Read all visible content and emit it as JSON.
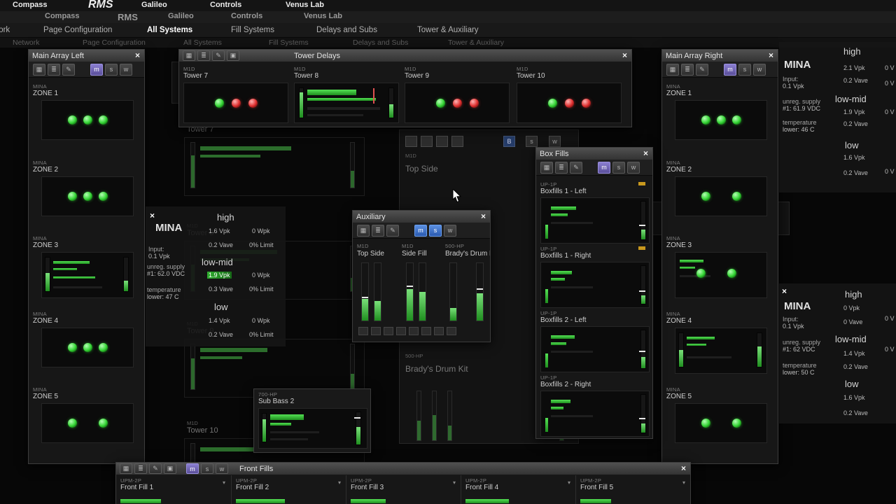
{
  "glyphs": {
    "grid": "▦",
    "list": "≣",
    "edit": "✎",
    "link": "▣",
    "close": "×",
    "m": "m",
    "s": "s",
    "w": "w",
    "b": "B",
    "arrow": "▾"
  },
  "menubar": {
    "items": [
      "Compass",
      "RMS",
      "Galileo",
      "Controls",
      "Venus Lab"
    ]
  },
  "tabs": {
    "network": "Network",
    "items": [
      "Page Configuration",
      "All Systems",
      "Fill Systems",
      "Delays and Subs",
      "Tower & Auxiliary"
    ]
  },
  "mal": {
    "title": "Main Array Left",
    "zones": [
      {
        "tag": "MINA",
        "name": "ZONE 1"
      },
      {
        "tag": "MINA",
        "name": "ZONE 2"
      },
      {
        "tag": "MINA",
        "name": "ZONE 3"
      },
      {
        "tag": "MINA",
        "name": "ZONE 4"
      },
      {
        "tag": "MINA",
        "name": "ZONE 5"
      }
    ]
  },
  "mar": {
    "title": "Main Array Right",
    "zones": [
      {
        "tag": "MINA",
        "name": "ZONE 1"
      },
      {
        "tag": "MINA",
        "name": "ZONE 2"
      },
      {
        "tag": "MINA",
        "name": "ZONE 3"
      },
      {
        "tag": "MINA",
        "name": "ZONE 4"
      },
      {
        "tag": "MINA",
        "name": "ZONE 5"
      }
    ]
  },
  "td": {
    "title": "Tower Delays",
    "towers": [
      {
        "tag": "M1D",
        "name": "Tower 7"
      },
      {
        "tag": "M1D",
        "name": "Tower 8"
      },
      {
        "tag": "M1D",
        "name": "Tower 9"
      },
      {
        "tag": "M1D",
        "name": "Tower 10"
      }
    ]
  },
  "aux": {
    "title": "Auxiliary",
    "channels": [
      {
        "tag": "M1D",
        "name": "Top Side"
      },
      {
        "tag": "M1D",
        "name": "Side Fill"
      },
      {
        "tag": "500-HP",
        "name": "Brady's Drum Kit"
      }
    ]
  },
  "bf": {
    "title": "Box Fills",
    "sections": [
      {
        "tag": "UP-1P",
        "name": "Boxfills 1 - Left"
      },
      {
        "tag": "UP-1P",
        "name": "Boxfills 1 - Right"
      },
      {
        "tag": "UP-1P",
        "name": "Boxfills 2 - Left"
      },
      {
        "tag": "UP-1P",
        "name": "Boxfills 2 - Right"
      }
    ]
  },
  "sb": {
    "tag": "700-HP",
    "name": "Sub Bass 2"
  },
  "ff": {
    "title": "Front Fills",
    "channels": [
      {
        "tag": "UPM-2P",
        "name": "Front Fill 1"
      },
      {
        "tag": "UPM-2P",
        "name": "Front Fill 2"
      },
      {
        "tag": "UPM-2P",
        "name": "Front Fill 3"
      },
      {
        "tag": "UPM-2P",
        "name": "Front Fill 4"
      },
      {
        "tag": "UPM-2P",
        "name": "Front Fill 5"
      }
    ]
  },
  "info_left": {
    "device": "MINA",
    "input_label": "Input:",
    "input": "0.1 Vpk",
    "supply_label": "unreg. supply",
    "supply": "#1: 62.0 VDC",
    "temp_label": "temperature",
    "temp": "lower: 47 C",
    "bands": [
      {
        "name": "high",
        "pk": "1.6 Vpk",
        "wpk": "0 Wpk",
        "ave": "0.2 Vave",
        "limit": "0% Limit"
      },
      {
        "name": "low-mid",
        "pk": "1.9 Vpk",
        "wpk": "0 Wpk",
        "ave": "0.3 Vave",
        "limit": "0% Limit"
      },
      {
        "name": "low",
        "pk": "1.4 Vpk",
        "wpk": "0 Wpk",
        "ave": "0.2 Vave",
        "limit": "0% Limit"
      }
    ]
  },
  "info_rt": {
    "device": "MINA",
    "input_label": "Input:",
    "input": "0.1 Vpk",
    "supply_label": "unreg. supply",
    "supply": "#1: 61.9 VDC",
    "temp_label": "temperature",
    "temp": "lower: 46 C",
    "bands": [
      {
        "name": "high",
        "pk": "2.1 Vpk",
        "ave": "0.2 Vave"
      },
      {
        "name": "low-mid",
        "pk": "1.9 Vpk",
        "ave": "0.2 Vave"
      },
      {
        "name": "low",
        "pk": "1.6 Vpk",
        "ave": "0.2 Vave"
      }
    ],
    "edge": [
      "0 V",
      "0 V",
      "0 V",
      "0 V"
    ]
  },
  "info_rb": {
    "device": "MINA",
    "input_label": "Input:",
    "input": "0.1 Vpk",
    "supply_label": "unreg. supply",
    "supply": "#1: 62 VDC",
    "temp_label": "temperature",
    "temp": "lower: 50 C",
    "bands": [
      {
        "name": "high",
        "pk": "0 Vpk",
        "ave": "0 Vave"
      },
      {
        "name": "low-mid",
        "pk": "1.4 Vpk",
        "ave": "0.2 Vave"
      },
      {
        "name": "low",
        "pk": "1.6 Vpk",
        "ave": "0.2 Vave"
      }
    ],
    "edge": [
      "0 V",
      "0 V"
    ]
  }
}
